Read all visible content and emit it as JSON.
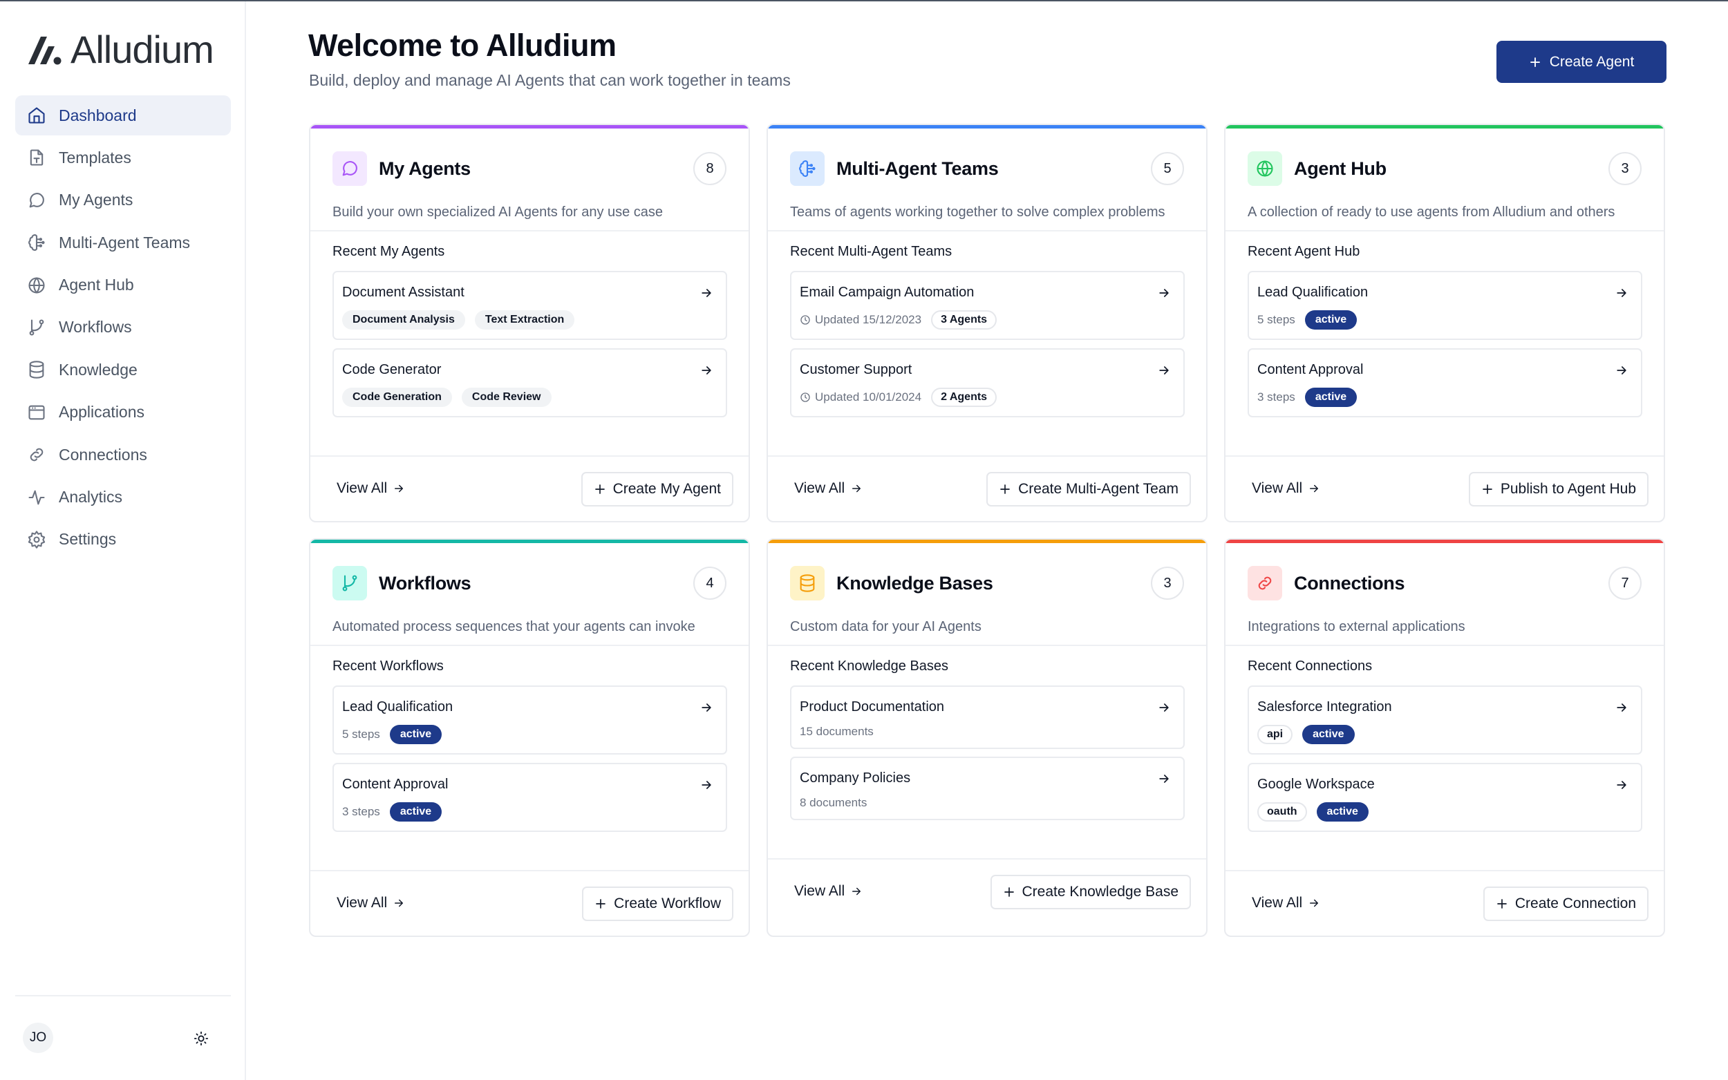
{
  "app": {
    "name": "Alludium"
  },
  "sidebar": {
    "items": [
      {
        "label": "Dashboard"
      },
      {
        "label": "Templates"
      },
      {
        "label": "My Agents"
      },
      {
        "label": "Multi-Agent Teams"
      },
      {
        "label": "Agent Hub"
      },
      {
        "label": "Workflows"
      },
      {
        "label": "Knowledge"
      },
      {
        "label": "Applications"
      },
      {
        "label": "Connections"
      },
      {
        "label": "Analytics"
      },
      {
        "label": "Settings"
      }
    ],
    "user_initials": "JO"
  },
  "header": {
    "title": "Welcome to Alludium",
    "subtitle": "Build, deploy and manage AI Agents that can work together in teams",
    "create_label": "Create Agent"
  },
  "colors": {
    "brand": "#1e3a8a",
    "my_agents": "#a855f7",
    "teams": "#3b82f6",
    "hub": "#22c55e",
    "workflows": "#14b8a6",
    "knowledge": "#f59e0b",
    "connections": "#ef4444"
  },
  "cards": {
    "my_agents": {
      "title": "My Agents",
      "count": "8",
      "description": "Build your own specialized AI Agents for any use case",
      "recent_label": "Recent My Agents",
      "items": [
        {
          "title": "Document Assistant",
          "tags": [
            "Document Analysis",
            "Text Extraction"
          ]
        },
        {
          "title": "Code Generator",
          "tags": [
            "Code Generation",
            "Code Review"
          ]
        }
      ],
      "view_all": "View All",
      "action": "Create My Agent"
    },
    "teams": {
      "title": "Multi-Agent Teams",
      "count": "5",
      "description": "Teams of agents working together to solve complex problems",
      "recent_label": "Recent Multi-Agent Teams",
      "items": [
        {
          "title": "Email Campaign Automation",
          "updated": "Updated 15/12/2023",
          "agents": "3 Agents"
        },
        {
          "title": "Customer Support",
          "updated": "Updated 10/01/2024",
          "agents": "2 Agents"
        }
      ],
      "view_all": "View All",
      "action": "Create Multi-Agent Team"
    },
    "hub": {
      "title": "Agent Hub",
      "count": "3",
      "description": "A collection of ready to use agents from Alludium and others",
      "recent_label": "Recent Agent Hub",
      "items": [
        {
          "title": "Lead Qualification",
          "steps": "5 steps",
          "status": "active"
        },
        {
          "title": "Content Approval",
          "steps": "3 steps",
          "status": "active"
        }
      ],
      "view_all": "View All",
      "action": "Publish to Agent Hub"
    },
    "workflows": {
      "title": "Workflows",
      "count": "4",
      "description": "Automated process sequences that your agents can invoke",
      "recent_label": "Recent Workflows",
      "items": [
        {
          "title": "Lead Qualification",
          "steps": "5 steps",
          "status": "active"
        },
        {
          "title": "Content Approval",
          "steps": "3 steps",
          "status": "active"
        }
      ],
      "view_all": "View All",
      "action": "Create Workflow"
    },
    "knowledge": {
      "title": "Knowledge Bases",
      "count": "3",
      "description": "Custom data for your AI Agents",
      "recent_label": "Recent Knowledge Bases",
      "items": [
        {
          "title": "Product Documentation",
          "docs": "15 documents"
        },
        {
          "title": "Company Policies",
          "docs": "8 documents"
        }
      ],
      "view_all": "View All",
      "action": "Create Knowledge Base"
    },
    "connections": {
      "title": "Connections",
      "count": "7",
      "description": "Integrations to external applications",
      "recent_label": "Recent Connections",
      "items": [
        {
          "title": "Salesforce Integration",
          "type": "api",
          "status": "active"
        },
        {
          "title": "Google Workspace",
          "type": "oauth",
          "status": "active"
        }
      ],
      "view_all": "View All",
      "action": "Create Connection"
    }
  }
}
